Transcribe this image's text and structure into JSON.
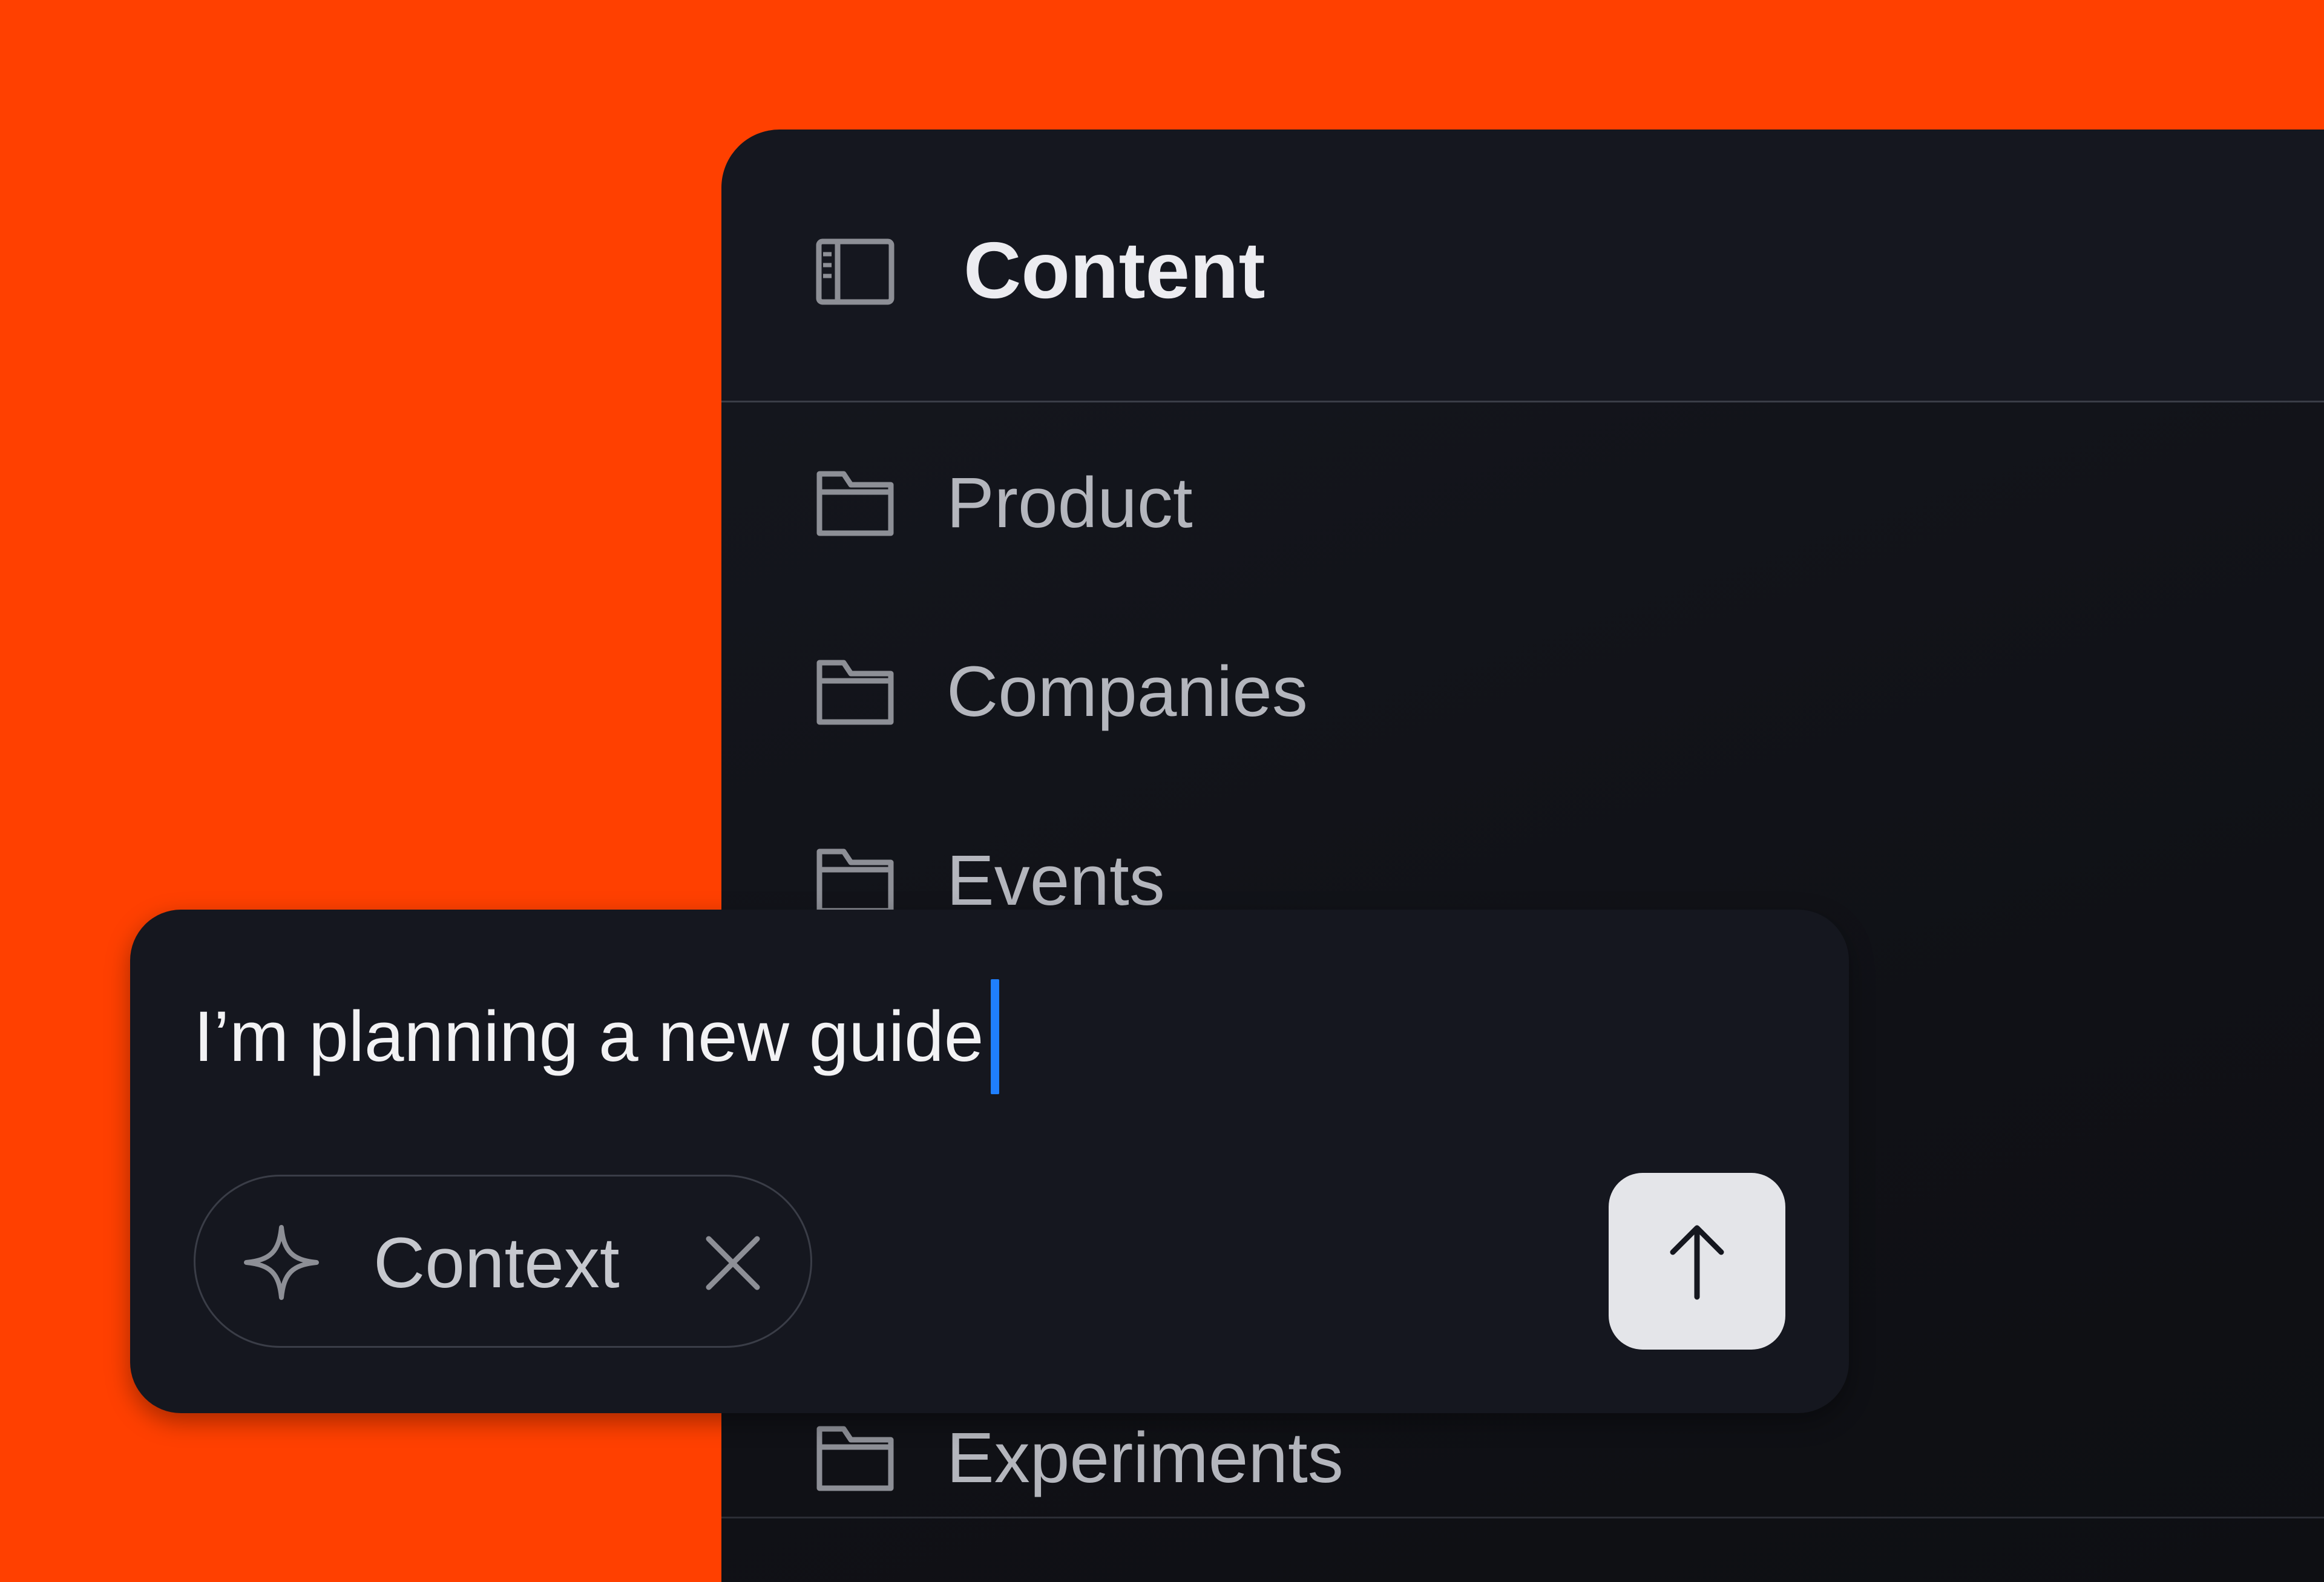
{
  "panel": {
    "title": "Content",
    "folders": [
      {
        "label": "Product",
        "icon": "folder-icon"
      },
      {
        "label": "Companies",
        "icon": "folder-icon"
      },
      {
        "label": "Events",
        "icon": "folder-icon"
      },
      {
        "label": "Experiments",
        "icon": "folder-icon"
      }
    ]
  },
  "composer": {
    "input_value": "I’m planning a new guide",
    "context_chip_label": "Context",
    "context_chip_icon": "sparkle-icon",
    "send_icon": "arrow-up-icon"
  },
  "colors": {
    "background": "#ff4000",
    "panel": "#15171f",
    "caret": "#1f7fff",
    "send_button": "#e4e5e9"
  }
}
